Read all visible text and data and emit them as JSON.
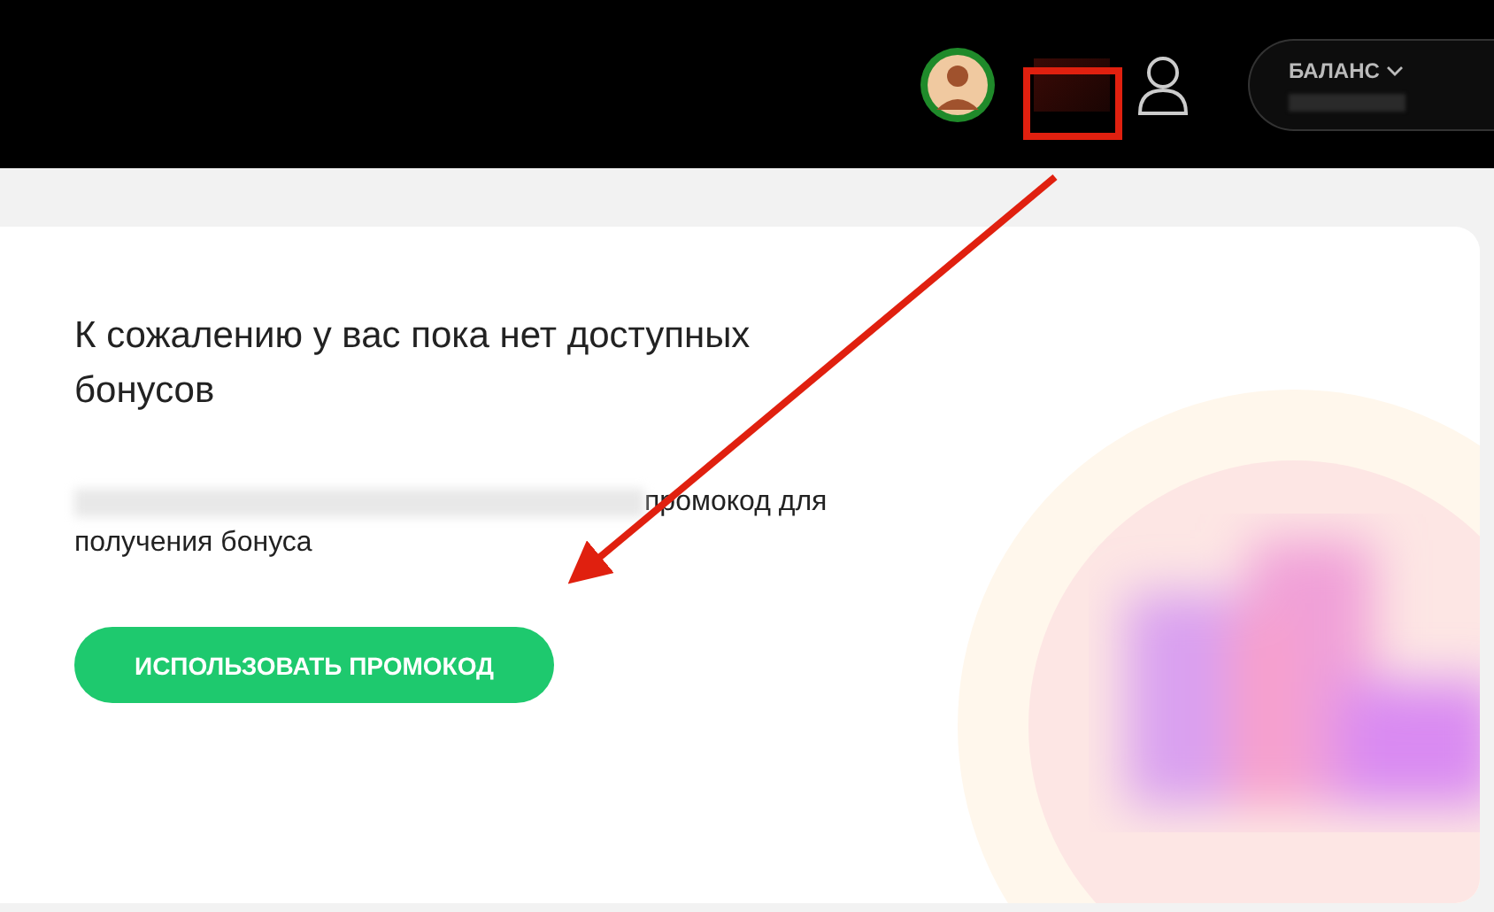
{
  "header": {
    "balance_label": "БАЛАНС"
  },
  "card": {
    "title": "К сожалению у вас пока нет доступных бонусов",
    "text_lines": [
      "промокод для",
      "получения бонуса"
    ],
    "button": "ИСПОЛЬЗОВАТЬ ПРОМОКОД"
  }
}
